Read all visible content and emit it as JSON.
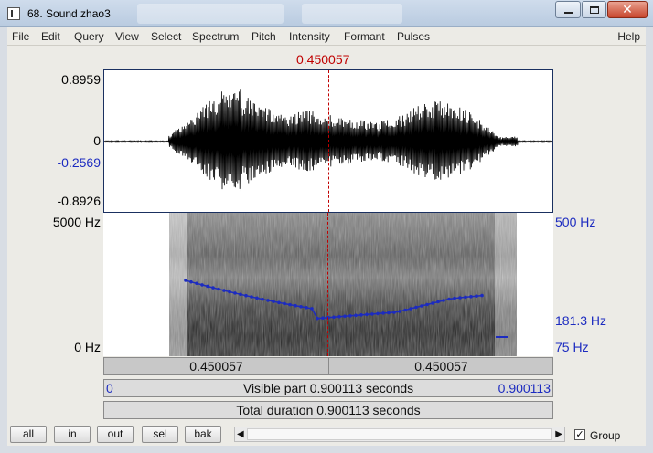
{
  "window": {
    "title": "68. Sound zhao3",
    "controls": {
      "minimize": "minimize",
      "maximize": "maximize",
      "close": "✕"
    }
  },
  "menu": {
    "items": [
      "File",
      "Edit",
      "Query",
      "View",
      "Select",
      "Spectrum",
      "Pitch",
      "Intensity",
      "Formant",
      "Pulses"
    ],
    "help": "Help"
  },
  "cursor": {
    "time": "0.450057"
  },
  "waveform": {
    "y_max": "0.8959",
    "y_zero": "0",
    "y_cursor": "-0.2569",
    "y_min": "-0.8926"
  },
  "spectrogram": {
    "freq_top": "5000 Hz",
    "freq_bottom": "0 Hz",
    "pitch_top": "500 Hz",
    "pitch_mid": "181.3 Hz",
    "pitch_bottom": "75 Hz"
  },
  "timebar": {
    "left": "0.450057",
    "right": "0.450057"
  },
  "visible": {
    "start": "0",
    "label": "Visible part 0.900113 seconds",
    "end": "0.900113"
  },
  "total": {
    "label": "Total duration 0.900113 seconds"
  },
  "buttons": {
    "all": "all",
    "in": "in",
    "out": "out",
    "sel": "sel",
    "bak": "bak"
  },
  "group": {
    "label": "Group",
    "checked": "✓"
  },
  "scrollbar": {
    "left_arrow": "◀",
    "right_arrow": "▶"
  },
  "colors": {
    "cursor": "#c00000",
    "pitch": "#1c2bc0"
  }
}
